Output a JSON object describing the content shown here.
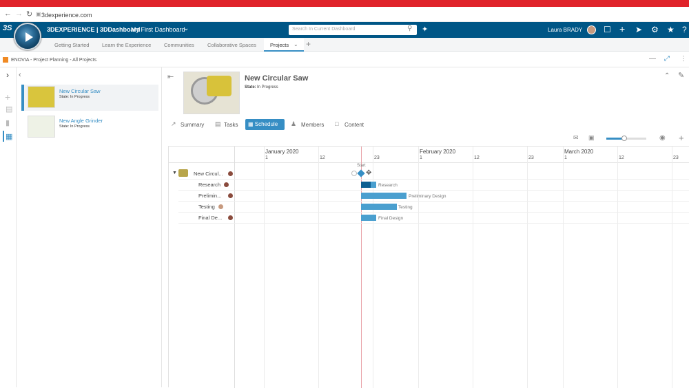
{
  "browser": {
    "url": "3dexperience.com"
  },
  "topbar": {
    "brand": "3DEXPERIENCE | 3DDashboard",
    "dashboard": "My First Dashboard",
    "search_placeholder": "Search In Current Dashboard",
    "user": "Laura BRADY"
  },
  "tabs": [
    "Getting Started",
    "Learn the Experience",
    "Communities",
    "Collaborative Spaces",
    "Projects"
  ],
  "breadcrumb": "ENOVIA - Project Planning - All Projects",
  "projects": [
    {
      "title": "New Circular Saw",
      "state": "State: In Progress"
    },
    {
      "title": "New Angle Grinder",
      "state": "State: In Progress"
    }
  ],
  "header": {
    "title": "New Circular Saw",
    "state_label": "State:",
    "state_value": "In Progress"
  },
  "view_tabs": {
    "summary": "Summary",
    "tasks": "Tasks",
    "schedule": "Schedule",
    "members": "Members",
    "content": "Content"
  },
  "gantt": {
    "months": [
      "January 2020",
      "February 2020",
      "March 2020"
    ],
    "days": [
      "1",
      "12",
      "23",
      "1",
      "12",
      "23",
      "1",
      "12",
      "23"
    ],
    "start_label": "Start",
    "rows": [
      "New Circul...",
      "Research",
      "Prelimin...",
      "Testing",
      "Final De..."
    ],
    "bar_labels": [
      "Research",
      "Preliminary Design",
      "Testing",
      "Final Design"
    ]
  },
  "colors": {
    "accent": "#368ec4",
    "topbar": "#005686",
    "redbar": "#e0232a",
    "bar": "#4a9fcf",
    "today": "#e8a0a6"
  }
}
